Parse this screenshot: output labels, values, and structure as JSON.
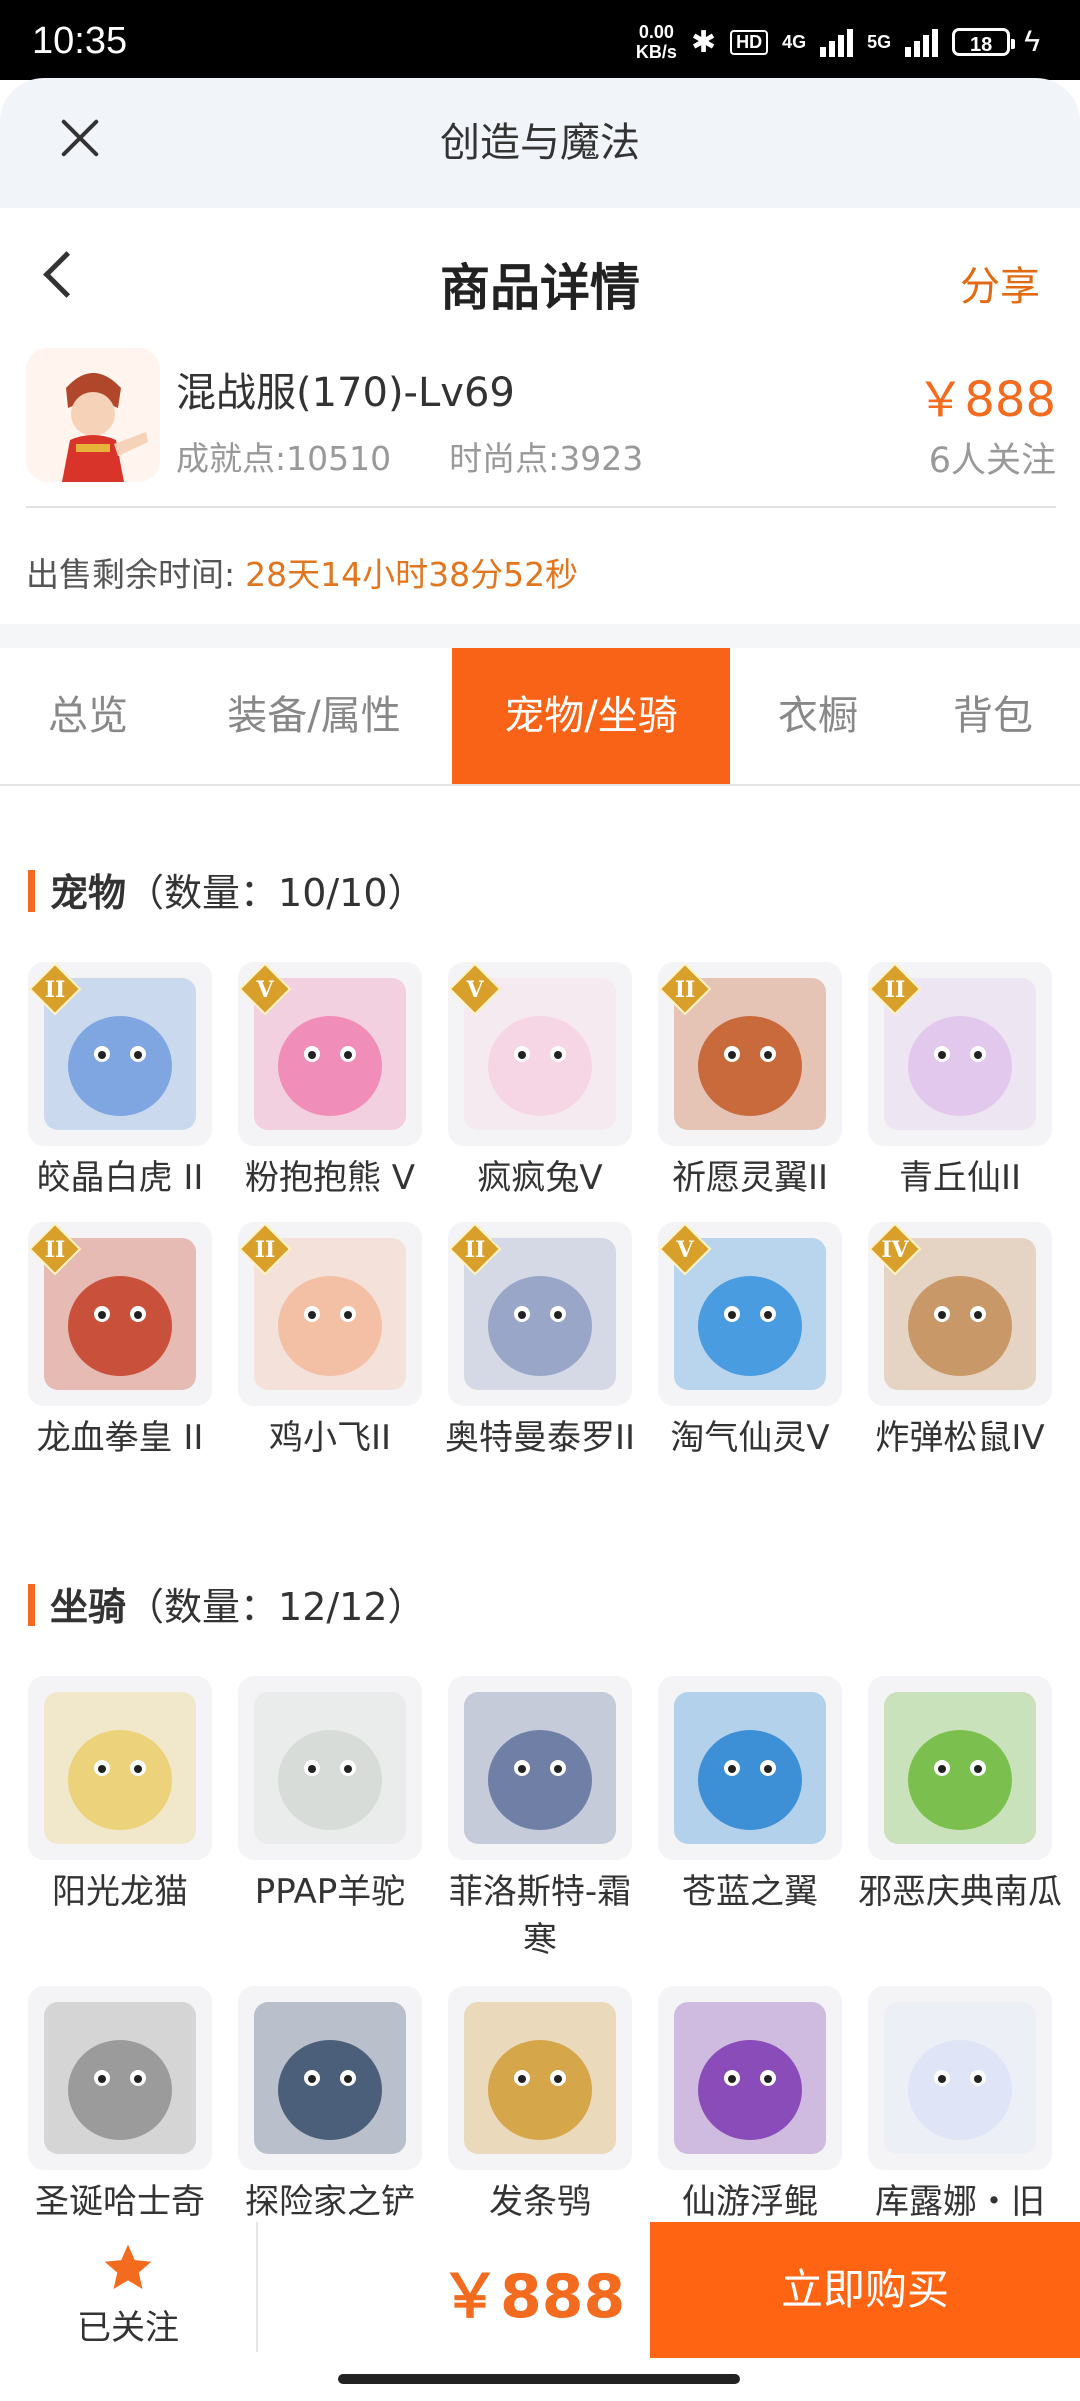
{
  "status_bar": {
    "time": "10:35",
    "net_speed_top": "0.00",
    "net_speed_bottom": "KB/s",
    "hd": "HD",
    "net1": "4G",
    "net2": "5G",
    "battery": "18"
  },
  "sheet": {
    "title": "创造与魔法"
  },
  "nav": {
    "title": "商品详情",
    "share": "分享"
  },
  "product": {
    "name": "混战服(170)-Lv69",
    "achievement": "成就点:10510",
    "fashion": "时尚点:3923",
    "price": "￥888",
    "followers": "6人关注"
  },
  "sale_time": {
    "label": "出售剩余时间:",
    "value": "28天14小时38分52秒"
  },
  "tabs": [
    {
      "label": "总览",
      "active": false
    },
    {
      "label": "装备/属性",
      "active": false
    },
    {
      "label": "宠物/坐骑",
      "active": true
    },
    {
      "label": "衣橱",
      "active": false
    },
    {
      "label": "背包",
      "active": false
    }
  ],
  "pets": {
    "title": "宠物",
    "count": "（数量：10/10）",
    "items": [
      {
        "name": "皎晶白虎 II",
        "rank": "II",
        "color": "#7fa6e0"
      },
      {
        "name": "粉抱抱熊 V",
        "rank": "V",
        "color": "#f08db8"
      },
      {
        "name": "疯疯兔V",
        "rank": "V",
        "color": "#f6d6e4"
      },
      {
        "name": "祈愿灵翼II",
        "rank": "II",
        "color": "#c86a3c"
      },
      {
        "name": "青丘仙II",
        "rank": "II",
        "color": "#e2c8ec"
      },
      {
        "name": "龙血拳皇 II",
        "rank": "II",
        "color": "#c9503a"
      },
      {
        "name": "鸡小飞II",
        "rank": "II",
        "color": "#f3c0a6"
      },
      {
        "name": "奥特曼泰罗II",
        "rank": "II",
        "color": "#9aa6c8"
      },
      {
        "name": "淘气仙灵V",
        "rank": "V",
        "color": "#4a9ce0"
      },
      {
        "name": "炸弹松鼠IV",
        "rank": "IV",
        "color": "#c89868"
      }
    ]
  },
  "mounts": {
    "title": "坐骑",
    "count": "（数量：12/12）",
    "items": [
      {
        "name": "阳光龙猫",
        "color": "#ecd27a"
      },
      {
        "name": "PPAP羊驼",
        "color": "#d8dcd8"
      },
      {
        "name": "菲洛斯特-霜寒",
        "color": "#6f7fa6"
      },
      {
        "name": "苍蓝之翼",
        "color": "#3d8fd6"
      },
      {
        "name": "邪恶庆典南瓜",
        "color": "#7bc04e"
      },
      {
        "name": "圣诞哈士奇",
        "color": "#9b9b9b"
      },
      {
        "name": "探险家之铲",
        "color": "#4c5f7a"
      },
      {
        "name": "发条鸮",
        "color": "#d6a64a"
      },
      {
        "name": "仙游浮鲲",
        "color": "#8a4cb8"
      },
      {
        "name": "库露娜・旧",
        "color": "#dfe4f6"
      }
    ]
  },
  "bottom": {
    "fav_label": "已关注",
    "price": "￥888",
    "buy": "立即购买"
  }
}
